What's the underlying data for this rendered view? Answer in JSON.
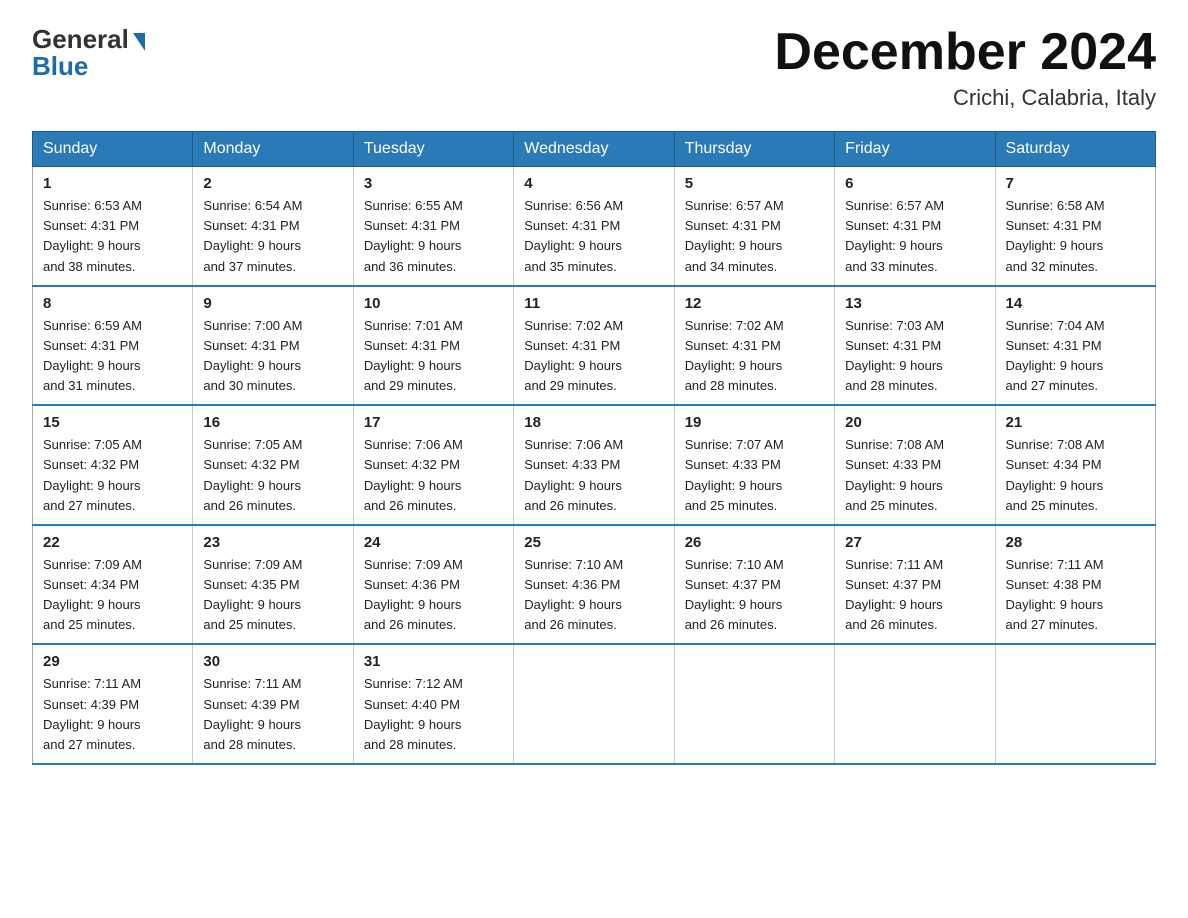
{
  "logo": {
    "general": "General",
    "blue": "Blue"
  },
  "header": {
    "title": "December 2024",
    "location": "Crichi, Calabria, Italy"
  },
  "days_of_week": [
    "Sunday",
    "Monday",
    "Tuesday",
    "Wednesday",
    "Thursday",
    "Friday",
    "Saturday"
  ],
  "weeks": [
    [
      {
        "day": "1",
        "sunrise": "6:53 AM",
        "sunset": "4:31 PM",
        "daylight": "9 hours and 38 minutes."
      },
      {
        "day": "2",
        "sunrise": "6:54 AM",
        "sunset": "4:31 PM",
        "daylight": "9 hours and 37 minutes."
      },
      {
        "day": "3",
        "sunrise": "6:55 AM",
        "sunset": "4:31 PM",
        "daylight": "9 hours and 36 minutes."
      },
      {
        "day": "4",
        "sunrise": "6:56 AM",
        "sunset": "4:31 PM",
        "daylight": "9 hours and 35 minutes."
      },
      {
        "day": "5",
        "sunrise": "6:57 AM",
        "sunset": "4:31 PM",
        "daylight": "9 hours and 34 minutes."
      },
      {
        "day": "6",
        "sunrise": "6:57 AM",
        "sunset": "4:31 PM",
        "daylight": "9 hours and 33 minutes."
      },
      {
        "day": "7",
        "sunrise": "6:58 AM",
        "sunset": "4:31 PM",
        "daylight": "9 hours and 32 minutes."
      }
    ],
    [
      {
        "day": "8",
        "sunrise": "6:59 AM",
        "sunset": "4:31 PM",
        "daylight": "9 hours and 31 minutes."
      },
      {
        "day": "9",
        "sunrise": "7:00 AM",
        "sunset": "4:31 PM",
        "daylight": "9 hours and 30 minutes."
      },
      {
        "day": "10",
        "sunrise": "7:01 AM",
        "sunset": "4:31 PM",
        "daylight": "9 hours and 29 minutes."
      },
      {
        "day": "11",
        "sunrise": "7:02 AM",
        "sunset": "4:31 PM",
        "daylight": "9 hours and 29 minutes."
      },
      {
        "day": "12",
        "sunrise": "7:02 AM",
        "sunset": "4:31 PM",
        "daylight": "9 hours and 28 minutes."
      },
      {
        "day": "13",
        "sunrise": "7:03 AM",
        "sunset": "4:31 PM",
        "daylight": "9 hours and 28 minutes."
      },
      {
        "day": "14",
        "sunrise": "7:04 AM",
        "sunset": "4:31 PM",
        "daylight": "9 hours and 27 minutes."
      }
    ],
    [
      {
        "day": "15",
        "sunrise": "7:05 AM",
        "sunset": "4:32 PM",
        "daylight": "9 hours and 27 minutes."
      },
      {
        "day": "16",
        "sunrise": "7:05 AM",
        "sunset": "4:32 PM",
        "daylight": "9 hours and 26 minutes."
      },
      {
        "day": "17",
        "sunrise": "7:06 AM",
        "sunset": "4:32 PM",
        "daylight": "9 hours and 26 minutes."
      },
      {
        "day": "18",
        "sunrise": "7:06 AM",
        "sunset": "4:33 PM",
        "daylight": "9 hours and 26 minutes."
      },
      {
        "day": "19",
        "sunrise": "7:07 AM",
        "sunset": "4:33 PM",
        "daylight": "9 hours and 25 minutes."
      },
      {
        "day": "20",
        "sunrise": "7:08 AM",
        "sunset": "4:33 PM",
        "daylight": "9 hours and 25 minutes."
      },
      {
        "day": "21",
        "sunrise": "7:08 AM",
        "sunset": "4:34 PM",
        "daylight": "9 hours and 25 minutes."
      }
    ],
    [
      {
        "day": "22",
        "sunrise": "7:09 AM",
        "sunset": "4:34 PM",
        "daylight": "9 hours and 25 minutes."
      },
      {
        "day": "23",
        "sunrise": "7:09 AM",
        "sunset": "4:35 PM",
        "daylight": "9 hours and 25 minutes."
      },
      {
        "day": "24",
        "sunrise": "7:09 AM",
        "sunset": "4:36 PM",
        "daylight": "9 hours and 26 minutes."
      },
      {
        "day": "25",
        "sunrise": "7:10 AM",
        "sunset": "4:36 PM",
        "daylight": "9 hours and 26 minutes."
      },
      {
        "day": "26",
        "sunrise": "7:10 AM",
        "sunset": "4:37 PM",
        "daylight": "9 hours and 26 minutes."
      },
      {
        "day": "27",
        "sunrise": "7:11 AM",
        "sunset": "4:37 PM",
        "daylight": "9 hours and 26 minutes."
      },
      {
        "day": "28",
        "sunrise": "7:11 AM",
        "sunset": "4:38 PM",
        "daylight": "9 hours and 27 minutes."
      }
    ],
    [
      {
        "day": "29",
        "sunrise": "7:11 AM",
        "sunset": "4:39 PM",
        "daylight": "9 hours and 27 minutes."
      },
      {
        "day": "30",
        "sunrise": "7:11 AM",
        "sunset": "4:39 PM",
        "daylight": "9 hours and 28 minutes."
      },
      {
        "day": "31",
        "sunrise": "7:12 AM",
        "sunset": "4:40 PM",
        "daylight": "9 hours and 28 minutes."
      },
      null,
      null,
      null,
      null
    ]
  ],
  "labels": {
    "sunrise": "Sunrise:",
    "sunset": "Sunset:",
    "daylight": "Daylight:"
  }
}
